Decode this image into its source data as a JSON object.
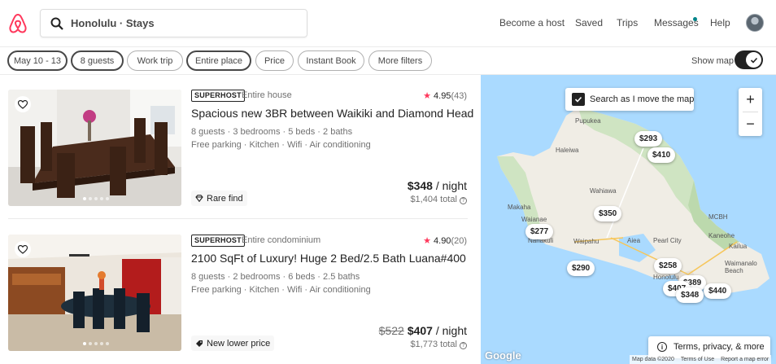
{
  "header": {
    "search_text": "Honolulu · Stays",
    "nav": [
      "Become a host",
      "Saved",
      "Trips",
      "Messages",
      "Help"
    ]
  },
  "filters": {
    "pills": [
      "May 10 - 13",
      "8 guests",
      "Work trip",
      "Entire place",
      "Price",
      "Instant Book",
      "More filters"
    ],
    "show_map_label": "Show map",
    "show_map_on": true
  },
  "listings": [
    {
      "badge": "SUPERHOST",
      "type": "Entire house",
      "rating": "4.95",
      "reviews": "(43)",
      "title": "Spacious new 3BR between Waikiki and Diamond Head",
      "amenities_1": "8 guests · 3 bedrooms · 5 beds · 2 baths",
      "amenities_2": "Free parking · Kitchen · Wifi · Air conditioning",
      "tag": "Rare find",
      "tag_icon": "diamond-icon",
      "old_price": "",
      "price": "$348",
      "per": " / night",
      "total": "$1,404 total"
    },
    {
      "badge": "SUPERHOST",
      "type": "Entire condominium",
      "rating": "4.90",
      "reviews": "(20)",
      "title": "2100 SqFt of Luxury! Huge 2 Bed/2.5 Bath Luana#400",
      "amenities_1": "8 guests · 2 bedrooms · 6 beds · 2.5 baths",
      "amenities_2": "Free parking · Kitchen · Wifi · Air conditioning",
      "tag": "New lower price",
      "tag_icon": "tag-icon",
      "old_price": "$522",
      "price": "$407",
      "per": " / night",
      "total": "$1,773 total"
    }
  ],
  "map": {
    "search_as_move": "Search as I move the map",
    "zoom_in": "+",
    "zoom_out": "−",
    "terms": "Terms, privacy, & more",
    "google": "Google",
    "attribution": [
      "Map data ©2020",
      "Terms of Use",
      "Report a map error"
    ],
    "places": [
      "Pupukea",
      "Haleiwa",
      "Wahiawa",
      "Makaha",
      "Waianae",
      "Nanakuli",
      "Waipahu",
      "Aiea",
      "Pearl City",
      "MCBH",
      "Kaneohe",
      "Kailua",
      "Waimanalo Beach",
      "Honolulu"
    ],
    "price_pins": [
      "$293",
      "$410",
      "$350",
      "$277",
      "$290",
      "$258",
      "$440",
      "$407",
      "$348",
      "$389"
    ]
  }
}
